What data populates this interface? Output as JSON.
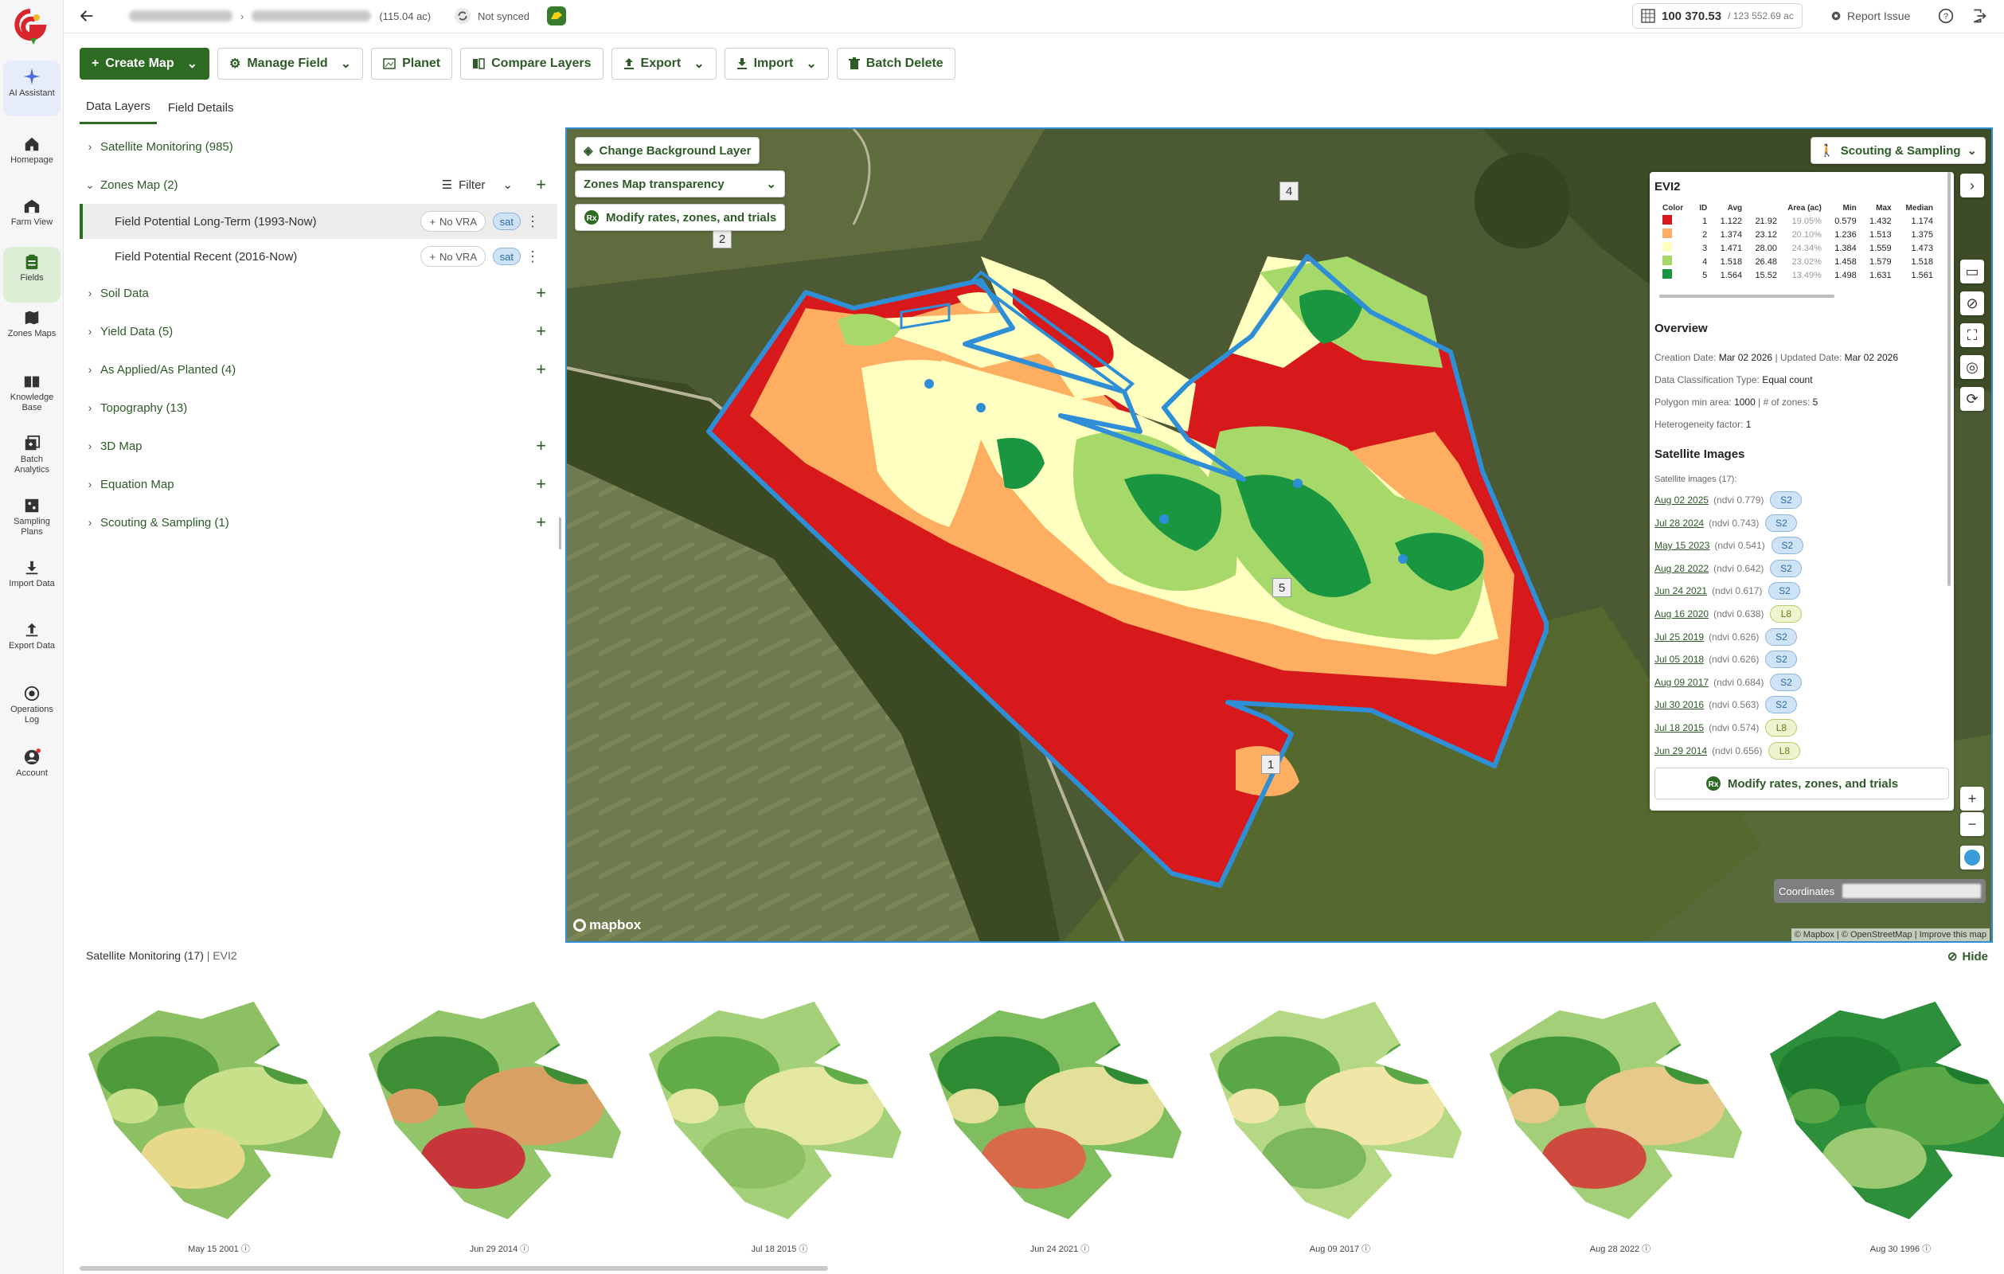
{
  "app": {
    "brand_color": "#2e6b22"
  },
  "rail": [
    {
      "id": "ai",
      "label": "AI Assistant",
      "icon": "sparkle-icon"
    },
    {
      "id": "home",
      "label": "Homepage",
      "icon": "home-icon"
    },
    {
      "id": "farm",
      "label": "Farm View",
      "icon": "barn-icon"
    },
    {
      "id": "fields",
      "label": "Fields",
      "icon": "clipboard-icon"
    },
    {
      "id": "zones",
      "label": "Zones Maps",
      "icon": "map-icon"
    },
    {
      "id": "knowledge",
      "label": "Knowledge Base",
      "icon": "book-icon"
    },
    {
      "id": "batch",
      "label": "Batch Analytics",
      "icon": "batch-icon"
    },
    {
      "id": "sampling",
      "label": "Sampling Plans",
      "icon": "sampling-icon"
    },
    {
      "id": "import",
      "label": "Import Data",
      "icon": "download-icon"
    },
    {
      "id": "export",
      "label": "Export Data",
      "icon": "upload-icon"
    },
    {
      "id": "oplog",
      "label": "Operations Log",
      "icon": "target-icon"
    },
    {
      "id": "account",
      "label": "Account",
      "icon": "user-icon"
    }
  ],
  "topbar": {
    "field_acres": "(115.04 ac)",
    "sync_status": "Not synced",
    "area_used": "100 370.53",
    "area_total": "/ 123 552.69 ac",
    "report_issue": "Report Issue"
  },
  "toolbar": {
    "create_map": "Create Map",
    "manage_field": "Manage Field",
    "planet": "Planet",
    "compare_layers": "Compare Layers",
    "export": "Export",
    "import": "Import",
    "batch_delete": "Batch Delete"
  },
  "tabs": [
    "Data Layers",
    "Field Details"
  ],
  "layers": {
    "satellite": "Satellite Monitoring (985)",
    "zones": "Zones Map (2)",
    "filter": "Filter",
    "zone_items": [
      {
        "label": "Field Potential Long-Term (1993-Now)",
        "vra": "No VRA",
        "badge": "sat"
      },
      {
        "label": "Field Potential Recent (2016-Now)",
        "vra": "No VRA",
        "badge": "sat"
      }
    ],
    "soil": "Soil Data",
    "yield": "Yield Data (5)",
    "applied": "As Applied/As Planted (4)",
    "topo": "Topography (13)",
    "map3d": "3D Map",
    "equation": "Equation Map",
    "scouting": "Scouting & Sampling (1)"
  },
  "map": {
    "change_bg": "Change Background Layer",
    "transparency": "Zones Map transparency",
    "modify": "Modify rates, zones, and trials",
    "scouting_btn": "Scouting & Sampling",
    "mapbox": "mapbox",
    "attribution": "© Mapbox | © OpenStreetMap | Improve this map",
    "coordinates_label": "Coordinates",
    "zone_labels": [
      "2",
      "4",
      "5",
      "1"
    ]
  },
  "info": {
    "title": "EVI2",
    "table_headers": [
      "Color",
      "ID",
      "Avg",
      "Area (ac)",
      "Min",
      "Max",
      "Median"
    ],
    "rows": [
      {
        "color": "#d7191c",
        "id": "1",
        "avg": "1.122",
        "area": "21.92",
        "pct": "19.05%",
        "min": "0.579",
        "max": "1.432",
        "median": "1.174"
      },
      {
        "color": "#fdae61",
        "id": "2",
        "avg": "1.374",
        "area": "23.12",
        "pct": "20.10%",
        "min": "1.236",
        "max": "1.513",
        "median": "1.375"
      },
      {
        "color": "#ffffbf",
        "id": "3",
        "avg": "1.471",
        "area": "28.00",
        "pct": "24.34%",
        "min": "1.384",
        "max": "1.559",
        "median": "1.473"
      },
      {
        "color": "#a6d96a",
        "id": "4",
        "avg": "1.518",
        "area": "26.48",
        "pct": "23.02%",
        "min": "1.458",
        "max": "1.579",
        "median": "1.518"
      },
      {
        "color": "#1a9641",
        "id": "5",
        "avg": "1.564",
        "area": "15.52",
        "pct": "13.49%",
        "min": "1.498",
        "max": "1.631",
        "median": "1.561"
      }
    ],
    "overview_title": "Overview",
    "creation_label": "Creation Date:",
    "creation_date": "Mar 02 2026",
    "updated_label": "| Updated Date:",
    "updated_date": "Mar 02 2026",
    "classification_label": "Data Classification Type:",
    "classification": "Equal count",
    "polygon_label": "Polygon min area:",
    "polygon": "1000",
    "zones_label": "| # of zones:",
    "zones": "5",
    "hetero_label": "Heterogeneity factor:",
    "hetero": "1",
    "sat_title": "Satellite Images",
    "sat_count": "Satellite images (17):",
    "images": [
      {
        "date": "Aug 02 2025",
        "ndvi": "(ndvi 0.779)",
        "sensor": "S2"
      },
      {
        "date": "Jul 28 2024",
        "ndvi": "(ndvi 0.743)",
        "sensor": "S2"
      },
      {
        "date": "May 15 2023",
        "ndvi": "(ndvi 0.541)",
        "sensor": "S2"
      },
      {
        "date": "Aug 28 2022",
        "ndvi": "(ndvi 0.642)",
        "sensor": "S2"
      },
      {
        "date": "Jun 24 2021",
        "ndvi": "(ndvi 0.617)",
        "sensor": "S2"
      },
      {
        "date": "Aug 16 2020",
        "ndvi": "(ndvi 0.638)",
        "sensor": "L8"
      },
      {
        "date": "Jul 25 2019",
        "ndvi": "(ndvi 0.626)",
        "sensor": "S2"
      },
      {
        "date": "Jul 05 2018",
        "ndvi": "(ndvi 0.626)",
        "sensor": "S2"
      },
      {
        "date": "Aug 09 2017",
        "ndvi": "(ndvi 0.684)",
        "sensor": "S2"
      },
      {
        "date": "Jul 30 2016",
        "ndvi": "(ndvi 0.563)",
        "sensor": "S2"
      },
      {
        "date": "Jul 18 2015",
        "ndvi": "(ndvi 0.574)",
        "sensor": "L8"
      },
      {
        "date": "Jun 29 2014",
        "ndvi": "(ndvi 0.656)",
        "sensor": "L8"
      }
    ],
    "modify": "Modify rates, zones, and trials"
  },
  "strip": {
    "title": "Satellite Monitoring",
    "count": "(17)",
    "layer": "| EVI2",
    "hide": "Hide",
    "thumbs": [
      {
        "date": "May 15 2001"
      },
      {
        "date": "Jun 29 2014"
      },
      {
        "date": "Jul 18 2015"
      },
      {
        "date": "Jun 24 2021"
      },
      {
        "date": "Aug 09 2017"
      },
      {
        "date": "Aug 28 2022"
      },
      {
        "date": "Aug 30 1996"
      }
    ]
  }
}
